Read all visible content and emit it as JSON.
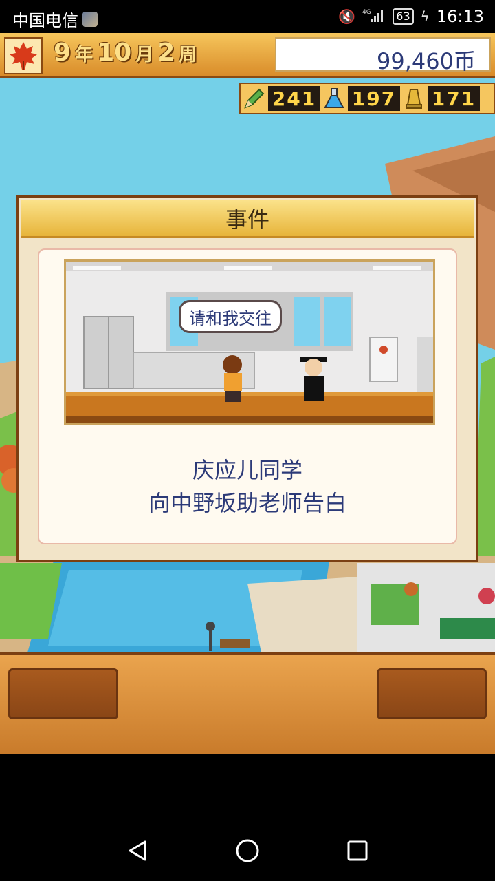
{
  "status_bar": {
    "carrier": "中国电信",
    "battery": "63",
    "time": "16:13",
    "network": "4G"
  },
  "hud": {
    "year_num": "9",
    "year_unit": "年",
    "month_num": "10",
    "month_unit": "月",
    "week_num": "2",
    "week_unit": "周",
    "money": "99,460币",
    "resources": [
      {
        "icon": "pencil-icon",
        "value": "241"
      },
      {
        "icon": "flask-icon",
        "value": "197"
      },
      {
        "icon": "trophy-icon",
        "value": "171"
      }
    ]
  },
  "dialog": {
    "title": "事件",
    "speech": "请和我交往",
    "line1": "庆应儿同学",
    "line2": "向中野坂助老师告白"
  },
  "colors": {
    "accent": "#2c3a78",
    "hud_gold": "#f5c65f",
    "panel_brown": "#c87a2a"
  }
}
